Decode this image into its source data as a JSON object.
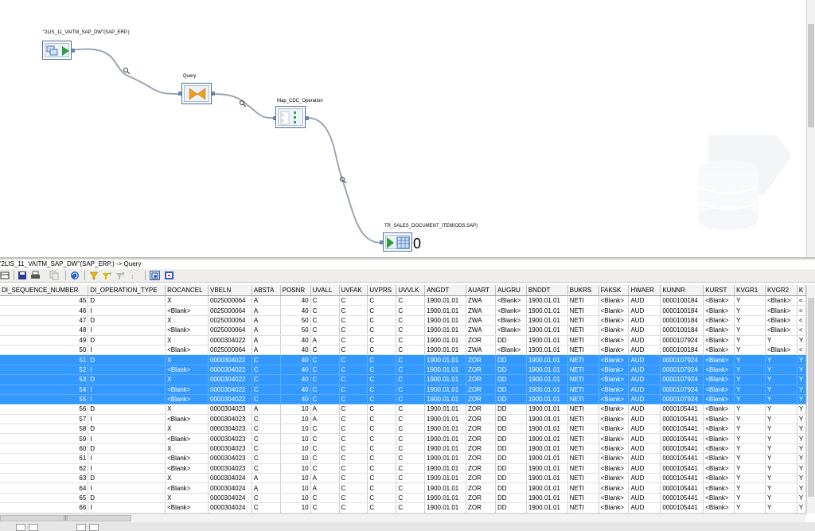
{
  "flow": {
    "source_label": "\"2LIS_11_VAITM_SAP_DW\"(SAP_ERP.)",
    "query_label": "Query",
    "map_label": "Map_CDC_Operation",
    "target_label": "TR_SALES_DOCUMENT_ITEM(ODS.SAP)",
    "target_count": "0"
  },
  "viewer": {
    "title": "'2LIS_11_VAITM_SAP_DW''(SAP_ERP.) -> Query"
  },
  "toolbar_icons": [
    "grid-icon",
    "save-icon",
    "print-icon",
    "copy-icon",
    "refresh-icon",
    "filter-icon",
    "add-filter-icon",
    "remove-filter-icon",
    "sort-icon",
    "compare-icon",
    "view-icon"
  ],
  "status": {
    "scroll_hint": "|||"
  },
  "grid": {
    "columns": [
      "DI_SEQUENCE_NUMBER",
      "DI_OPERATION_TYPE",
      "ROCANCEL",
      "VBELN",
      "ABSTA",
      "POSNR",
      "UVALL",
      "UVFAK",
      "UVPRS",
      "UVVLK",
      "ANGDT",
      "AUART",
      "AUGRU",
      "BNDDT",
      "BUKRS",
      "FAKSK",
      "HWAER",
      "KUNNR",
      "KURST",
      "KVGR1",
      "KVGR2",
      "K"
    ],
    "rows": [
      {
        "sel": false,
        "cells": [
          "45",
          "D",
          "X",
          "0025000064",
          "A",
          "40",
          "C",
          "C",
          "C",
          "C",
          "1900.01.01",
          "ZWA",
          "<Blank>",
          "1900.01.01",
          "NETI",
          "<Blank>",
          "AUD",
          "0000100184",
          "<Blank>",
          "Y",
          "<Blank>",
          "<"
        ]
      },
      {
        "sel": false,
        "cells": [
          "46",
          "I",
          "<Blank>",
          "0025000064",
          "A",
          "40",
          "C",
          "C",
          "C",
          "C",
          "1900.01.01",
          "ZWA",
          "<Blank>",
          "1900.01.01",
          "NETI",
          "<Blank>",
          "AUD",
          "0000100184",
          "<Blank>",
          "Y",
          "<Blank>",
          "<"
        ]
      },
      {
        "sel": false,
        "cells": [
          "47",
          "D",
          "X",
          "0025000064",
          "A",
          "50",
          "C",
          "C",
          "C",
          "C",
          "1900.01.01",
          "ZWA",
          "<Blank>",
          "1900.01.01",
          "NETI",
          "<Blank>",
          "AUD",
          "0000100184",
          "<Blank>",
          "Y",
          "<Blank>",
          "<"
        ]
      },
      {
        "sel": false,
        "cells": [
          "48",
          "I",
          "<Blank>",
          "0025000064",
          "A",
          "50",
          "C",
          "C",
          "C",
          "C",
          "1900.01.01",
          "ZWA",
          "<Blank>",
          "1900.01.01",
          "NETI",
          "<Blank>",
          "AUD",
          "0000100184",
          "<Blank>",
          "Y",
          "<Blank>",
          "<"
        ]
      },
      {
        "sel": false,
        "cells": [
          "49",
          "D",
          "X",
          "0000304022",
          "A",
          "40",
          "A",
          "C",
          "C",
          "C",
          "1900.01.01",
          "ZOR",
          "DD",
          "1900.01.01",
          "NETI",
          "<Blank>",
          "AUD",
          "0000107924",
          "<Blank>",
          "Y",
          "Y",
          "Y"
        ]
      },
      {
        "sel": false,
        "cells": [
          "50",
          "I",
          "<Blank>",
          "0025000064",
          "A",
          "40",
          "C",
          "C",
          "C",
          "C",
          "1900.01.01",
          "ZWA",
          "<Blank>",
          "1900.01.01",
          "NETI",
          "<Blank>",
          "AUD",
          "0000100184",
          "<Blank>",
          "Y",
          "<Blank>",
          "<"
        ]
      },
      {
        "sel": true,
        "cells": [
          "51",
          "D",
          "X",
          "0000304022",
          "C",
          "40",
          "C",
          "C",
          "C",
          "C",
          "1900.01.01",
          "ZOR",
          "DD",
          "1900.01.01",
          "NETI",
          "<Blank>",
          "AUD",
          "0000107924",
          "<Blank>",
          "Y",
          "Y",
          "Y"
        ]
      },
      {
        "sel": true,
        "cells": [
          "52",
          "I",
          "<Blank>",
          "0000304022",
          "C",
          "40",
          "C",
          "C",
          "C",
          "C",
          "1900.01.01",
          "ZOR",
          "DD",
          "1900.01.01",
          "NETI",
          "<Blank>",
          "AUD",
          "0000107924",
          "<Blank>",
          "Y",
          "Y",
          "Y"
        ]
      },
      {
        "sel": true,
        "cells": [
          "53",
          "D",
          "X",
          "0000304022",
          "C",
          "40",
          "C",
          "C",
          "C",
          "C",
          "1900.01.01",
          "ZOR",
          "DD",
          "1900.01.01",
          "NETI",
          "<Blank>",
          "AUD",
          "0000107924",
          "<Blank>",
          "Y",
          "Y",
          "Y"
        ]
      },
      {
        "sel": true,
        "cells": [
          "54",
          "I",
          "<Blank>",
          "0000304022",
          "C",
          "40",
          "C",
          "C",
          "C",
          "C",
          "1900.01.01",
          "ZOR",
          "DD",
          "1900.01.01",
          "NETI",
          "<Blank>",
          "AUD",
          "0000107924",
          "<Blank>",
          "Y",
          "Y",
          "Y"
        ]
      },
      {
        "sel": true,
        "cells": [
          "55",
          "I",
          "<Blank>",
          "0000304022",
          "C",
          "40",
          "C",
          "C",
          "C",
          "C",
          "1900.01.01",
          "ZOR",
          "DD",
          "1900.01.01",
          "NETI",
          "<Blank>",
          "AUD",
          "0000107924",
          "<Blank>",
          "Y",
          "Y",
          "Y"
        ]
      },
      {
        "sel": false,
        "cells": [
          "56",
          "D",
          "X",
          "0000304023",
          "A",
          "10",
          "A",
          "C",
          "C",
          "C",
          "1900.01.01",
          "ZOR",
          "DD",
          "1900.01.01",
          "NETI",
          "<Blank>",
          "AUD",
          "0000105441",
          "<Blank>",
          "Y",
          "Y",
          "Y"
        ]
      },
      {
        "sel": false,
        "cells": [
          "57",
          "I",
          "<Blank>",
          "0000304023",
          "C",
          "10",
          "A",
          "C",
          "C",
          "C",
          "1900.01.01",
          "ZOR",
          "DD",
          "1900.01.01",
          "NETI",
          "<Blank>",
          "AUD",
          "0000105441",
          "<Blank>",
          "Y",
          "Y",
          "Y"
        ]
      },
      {
        "sel": false,
        "cells": [
          "58",
          "D",
          "X",
          "0000304023",
          "C",
          "10",
          "C",
          "C",
          "C",
          "C",
          "1900.01.01",
          "ZOR",
          "DD",
          "1900.01.01",
          "NETI",
          "<Blank>",
          "AUD",
          "0000105441",
          "<Blank>",
          "Y",
          "Y",
          "Y"
        ]
      },
      {
        "sel": false,
        "cells": [
          "59",
          "I",
          "<Blank>",
          "0000304023",
          "C",
          "10",
          "C",
          "C",
          "C",
          "C",
          "1900.01.01",
          "ZOR",
          "DD",
          "1900.01.01",
          "NETI",
          "<Blank>",
          "AUD",
          "0000105441",
          "<Blank>",
          "Y",
          "Y",
          "Y"
        ]
      },
      {
        "sel": false,
        "cells": [
          "60",
          "D",
          "X",
          "0000304023",
          "C",
          "10",
          "C",
          "C",
          "C",
          "C",
          "1900.01.01",
          "ZOR",
          "DD",
          "1900.01.01",
          "NETI",
          "<Blank>",
          "AUD",
          "0000105441",
          "<Blank>",
          "Y",
          "Y",
          "Y"
        ]
      },
      {
        "sel": false,
        "cells": [
          "61",
          "I",
          "<Blank>",
          "0000304023",
          "C",
          "10",
          "C",
          "C",
          "C",
          "C",
          "1900.01.01",
          "ZOR",
          "DD",
          "1900.01.01",
          "NETI",
          "<Blank>",
          "AUD",
          "0000105441",
          "<Blank>",
          "Y",
          "Y",
          "Y"
        ]
      },
      {
        "sel": false,
        "cells": [
          "62",
          "I",
          "<Blank>",
          "0000304023",
          "C",
          "10",
          "C",
          "C",
          "C",
          "C",
          "1900.01.01",
          "ZOR",
          "DD",
          "1900.01.01",
          "NETI",
          "<Blank>",
          "AUD",
          "0000105441",
          "<Blank>",
          "Y",
          "Y",
          "Y"
        ]
      },
      {
        "sel": false,
        "cells": [
          "63",
          "D",
          "X",
          "0000304024",
          "A",
          "10",
          "A",
          "C",
          "C",
          "C",
          "1900.01.01",
          "ZOR",
          "DD",
          "1900.01.01",
          "NETI",
          "<Blank>",
          "AUD",
          "0000105441",
          "<Blank>",
          "Y",
          "Y",
          "Y"
        ]
      },
      {
        "sel": false,
        "cells": [
          "64",
          "I",
          "<Blank>",
          "0000304024",
          "A",
          "10",
          "A",
          "C",
          "C",
          "C",
          "1900.01.01",
          "ZOR",
          "DD",
          "1900.01.01",
          "NETI",
          "<Blank>",
          "AUD",
          "0000105441",
          "<Blank>",
          "Y",
          "Y",
          "Y"
        ]
      },
      {
        "sel": false,
        "cells": [
          "65",
          "D",
          "X",
          "0000304024",
          "C",
          "10",
          "C",
          "C",
          "C",
          "C",
          "1900.01.01",
          "ZOR",
          "DD",
          "1900.01.01",
          "NETI",
          "<Blank>",
          "AUD",
          "0000105441",
          "<Blank>",
          "Y",
          "Y",
          "Y"
        ]
      },
      {
        "sel": false,
        "cells": [
          "66",
          "I",
          "<Blank>",
          "0000304024",
          "C",
          "10",
          "C",
          "C",
          "C",
          "C",
          "1900.01.01",
          "ZOR",
          "DD",
          "1900.01.01",
          "NETI",
          "<Blank>",
          "AUD",
          "0000105441",
          "<Blank>",
          "Y",
          "Y",
          "Y"
        ]
      }
    ]
  },
  "colors": {
    "selection": "#3399ff",
    "node_border": "#4f6f9f",
    "connector": "#9aa6b4"
  }
}
